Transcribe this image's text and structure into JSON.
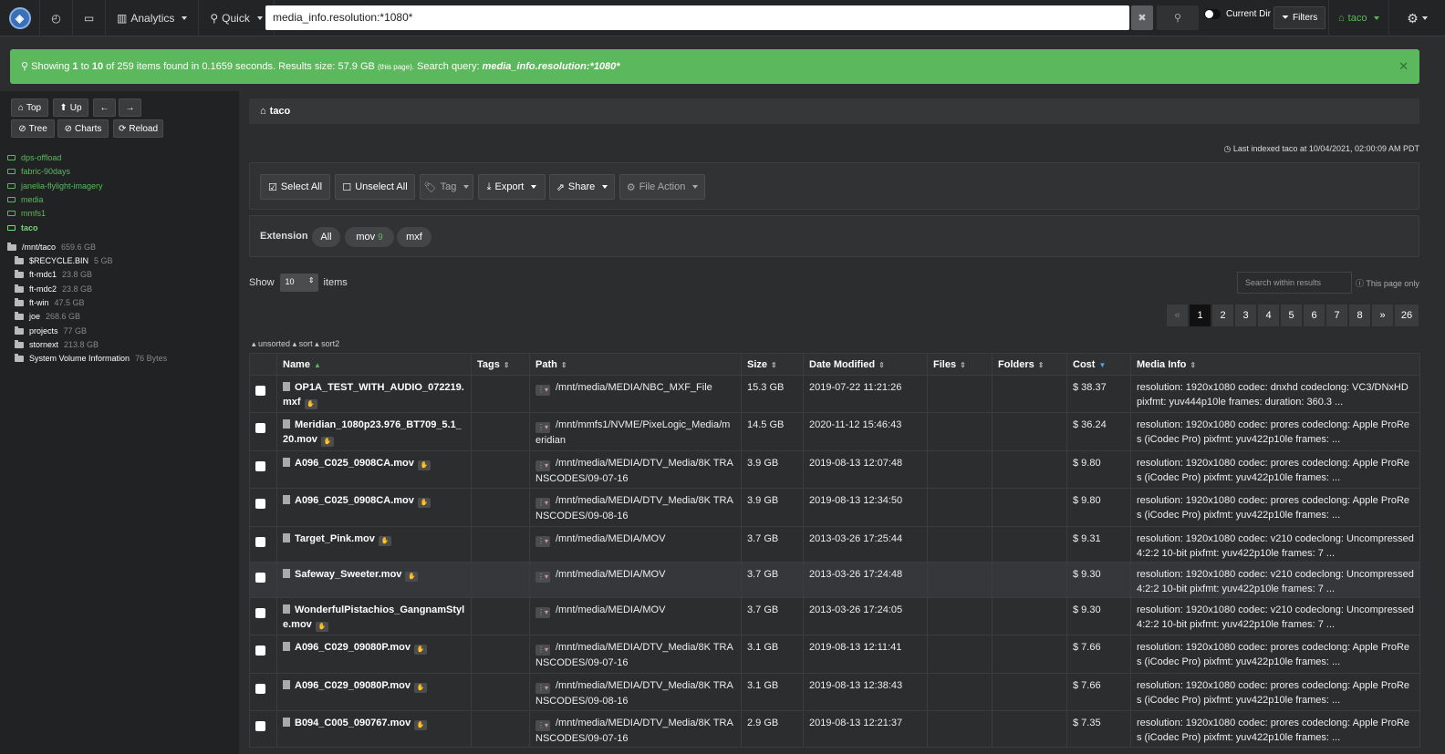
{
  "topbar": {
    "analytics": "Analytics",
    "quick": "Quick",
    "search_value": "media_info.resolution:*1080*",
    "current_dir": "Current Dir",
    "filters": "Filters",
    "user": "taco"
  },
  "alert": {
    "prefix": "Showing",
    "from": "1",
    "to_word": "to",
    "to": "10",
    "of_text": "of 259 items found in 0.1659 seconds. Results size: 57.9 GB",
    "this_page": "(this page).",
    "query_label": "Search query:",
    "query": "media_info.resolution:*1080*"
  },
  "sidebar": {
    "buttons": {
      "top": "Top",
      "up": "Up",
      "tree": "Tree",
      "charts": "Charts",
      "reload": "Reload"
    },
    "indices": [
      "dps-offload",
      "fabric-90days",
      "janelia-flylight-imagery",
      "media",
      "mmfs1",
      "taco"
    ],
    "tree": [
      {
        "name": "/mnt/taco",
        "size": "659.6 GB"
      },
      {
        "name": "$RECYCLE.BIN",
        "size": "5 GB"
      },
      {
        "name": "ft-mdc1",
        "size": "23.8 GB"
      },
      {
        "name": "ft-mdc2",
        "size": "23.8 GB"
      },
      {
        "name": "ft-win",
        "size": "47.5 GB"
      },
      {
        "name": "joe",
        "size": "268.6 GB"
      },
      {
        "name": "projects",
        "size": "77 GB"
      },
      {
        "name": "stornext",
        "size": "213.8 GB"
      },
      {
        "name": "System Volume Information",
        "size": "76 Bytes"
      }
    ]
  },
  "breadcrumb": "taco",
  "last_indexed": "Last indexed taco at 10/04/2021, 02:00:09 AM PDT",
  "actions": {
    "select_all": "Select All",
    "unselect_all": "Unselect All",
    "tag": "Tag",
    "export": "Export",
    "share": "Share",
    "file_action": "File Action"
  },
  "extension": {
    "label": "Extension",
    "all": "All",
    "mov": "mov",
    "mov_count": "9",
    "mxf": "mxf"
  },
  "show": {
    "label": "Show",
    "value": "10",
    "suffix": "items"
  },
  "search_within": {
    "placeholder": "Search within results",
    "note": "This page only"
  },
  "pager": [
    "«",
    "1",
    "2",
    "3",
    "4",
    "5",
    "6",
    "7",
    "8",
    "»",
    "26"
  ],
  "sort_info": {
    "unsorted": "unsorted",
    "sort": "sort",
    "sort2": "sort2"
  },
  "columns": {
    "name": "Name",
    "tags": "Tags",
    "path": "Path",
    "size": "Size",
    "modified": "Date Modified",
    "files": "Files",
    "folders": "Folders",
    "cost": "Cost",
    "media": "Media Info"
  },
  "rows": [
    {
      "name": "OP1A_TEST_WITH_AUDIO_072219.mxf",
      "path": "/mnt/media/MEDIA/NBC_MXF_File",
      "size": "15.3 GB",
      "modified": "2019-07-22 11:21:26",
      "cost": "$ 38.37",
      "media": "resolution: 1920x1080 codec: dnxhd codeclong: VC3/DNxHD pixfmt: yuv444p10le frames: duration: 360.3 ..."
    },
    {
      "name": "Meridian_1080p23.976_BT709_5.1_20.mov",
      "path": "/mnt/mmfs1/NVME/PixeLogic_Media/meridian",
      "size": "14.5 GB",
      "modified": "2020-11-12 15:46:43",
      "cost": "$ 36.24",
      "media": "resolution: 1920x1080 codec: prores codeclong: Apple ProRes (iCodec Pro) pixfmt: yuv422p10le frames: ..."
    },
    {
      "name": "A096_C025_0908CA.mov",
      "path": "/mnt/media/MEDIA/DTV_Media/8K TRANSCODES/09-07-16",
      "size": "3.9 GB",
      "modified": "2019-08-13 12:07:48",
      "cost": "$ 9.80",
      "media": "resolution: 1920x1080 codec: prores codeclong: Apple ProRes (iCodec Pro) pixfmt: yuv422p10le frames: ..."
    },
    {
      "name": "A096_C025_0908CA.mov",
      "path": "/mnt/media/MEDIA/DTV_Media/8K TRANSCODES/09-08-16",
      "size": "3.9 GB",
      "modified": "2019-08-13 12:34:50",
      "cost": "$ 9.80",
      "media": "resolution: 1920x1080 codec: prores codeclong: Apple ProRes (iCodec Pro) pixfmt: yuv422p10le frames: ..."
    },
    {
      "name": "Target_Pink.mov",
      "path": "/mnt/media/MEDIA/MOV",
      "size": "3.7 GB",
      "modified": "2013-03-26 17:25:44",
      "cost": "$ 9.31",
      "media": "resolution: 1920x1080 codec: v210 codeclong: Uncompressed 4:2:2 10-bit pixfmt: yuv422p10le frames: 7 ..."
    },
    {
      "name": "Safeway_Sweeter.mov",
      "path": "/mnt/media/MEDIA/MOV",
      "size": "3.7 GB",
      "modified": "2013-03-26 17:24:48",
      "cost": "$ 9.30",
      "media": "resolution: 1920x1080 codec: v210 codeclong: Uncompressed 4:2:2 10-bit pixfmt: yuv422p10le frames: 7 ..."
    },
    {
      "name": "WonderfulPistachios_GangnamStyle.mov",
      "path": "/mnt/media/MEDIA/MOV",
      "size": "3.7 GB",
      "modified": "2013-03-26 17:24:05",
      "cost": "$ 9.30",
      "media": "resolution: 1920x1080 codec: v210 codeclong: Uncompressed 4:2:2 10-bit pixfmt: yuv422p10le frames: 7 ..."
    },
    {
      "name": "A096_C029_09080P.mov",
      "path": "/mnt/media/MEDIA/DTV_Media/8K TRANSCODES/09-07-16",
      "size": "3.1 GB",
      "modified": "2019-08-13 12:11:41",
      "cost": "$ 7.66",
      "media": "resolution: 1920x1080 codec: prores codeclong: Apple ProRes (iCodec Pro) pixfmt: yuv422p10le frames: ..."
    },
    {
      "name": "A096_C029_09080P.mov",
      "path": "/mnt/media/MEDIA/DTV_Media/8K TRANSCODES/09-08-16",
      "size": "3.1 GB",
      "modified": "2019-08-13 12:38:43",
      "cost": "$ 7.66",
      "media": "resolution: 1920x1080 codec: prores codeclong: Apple ProRes (iCodec Pro) pixfmt: yuv422p10le frames: ..."
    },
    {
      "name": "B094_C005_090767.mov",
      "path": "/mnt/media/MEDIA/DTV_Media/8K TRANSCODES/09-07-16",
      "size": "2.9 GB",
      "modified": "2019-08-13 12:21:37",
      "cost": "$ 7.35",
      "media": "resolution: 1920x1080 codec: prores codeclong: Apple ProRes (iCodec Pro) pixfmt: yuv422p10le frames: ..."
    }
  ],
  "colors": {
    "accent": "#5cb85c",
    "background": "#2b2d2f",
    "sidebar": "#202224"
  }
}
